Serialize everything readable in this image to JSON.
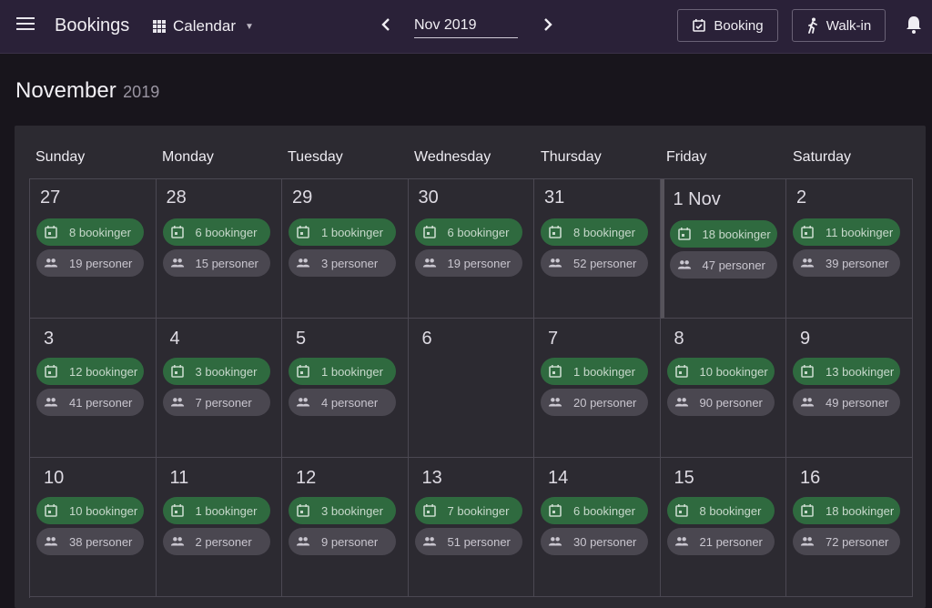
{
  "header": {
    "title": "Bookings",
    "view_label": "Calendar",
    "month_value": "Nov 2019",
    "booking_button": "Booking",
    "walkin_button": "Walk-in"
  },
  "page": {
    "month": "November",
    "year": "2019"
  },
  "weekdays": [
    "Sunday",
    "Monday",
    "Tuesday",
    "Wednesday",
    "Thursday",
    "Friday",
    "Saturday"
  ],
  "weeks": [
    [
      {
        "day": "27",
        "bookings": "8 bookinger",
        "persons": "19 personer"
      },
      {
        "day": "28",
        "bookings": "6 bookinger",
        "persons": "15 personer"
      },
      {
        "day": "29",
        "bookings": "1 bookinger",
        "persons": "3 personer"
      },
      {
        "day": "30",
        "bookings": "6 bookinger",
        "persons": "19 personer"
      },
      {
        "day": "31",
        "bookings": "8 bookinger",
        "persons": "52 personer"
      },
      {
        "day": "1  Nov",
        "bookings": "18 bookinger",
        "persons": "47 personer",
        "today": true
      },
      {
        "day": "2",
        "bookings": "11 bookinger",
        "persons": "39 personer"
      }
    ],
    [
      {
        "day": "3",
        "bookings": "12 bookinger",
        "persons": "41 personer"
      },
      {
        "day": "4",
        "bookings": "3 bookinger",
        "persons": "7 personer"
      },
      {
        "day": "5",
        "bookings": "1 bookinger",
        "persons": "4 personer"
      },
      {
        "day": "6",
        "bookings": "",
        "persons": ""
      },
      {
        "day": "7",
        "bookings": "1 bookinger",
        "persons": "20 personer"
      },
      {
        "day": "8",
        "bookings": "10 bookinger",
        "persons": "90 personer"
      },
      {
        "day": "9",
        "bookings": "13 bookinger",
        "persons": "49 personer"
      }
    ],
    [
      {
        "day": "10",
        "bookings": "10 bookinger",
        "persons": "38 personer"
      },
      {
        "day": "11",
        "bookings": "1 bookinger",
        "persons": "2 personer"
      },
      {
        "day": "12",
        "bookings": "3 bookinger",
        "persons": "9 personer"
      },
      {
        "day": "13",
        "bookings": "7 bookinger",
        "persons": "51 personer"
      },
      {
        "day": "14",
        "bookings": "6 bookinger",
        "persons": "30 personer"
      },
      {
        "day": "15",
        "bookings": "8 bookinger",
        "persons": "21 personer"
      },
      {
        "day": "16",
        "bookings": "18 bookinger",
        "persons": "72 personer"
      }
    ]
  ],
  "icons": {
    "menu": "menu-icon",
    "view": "grid-view-icon",
    "prev": "chevron-left-icon",
    "next": "chevron-right-icon",
    "booking": "calendar-check-icon",
    "walkin": "walking-person-icon",
    "bell": "bell-icon",
    "chip_booking": "calendar-icon",
    "chip_persons": "people-icon"
  },
  "colors": {
    "topbar": "#2a2138",
    "background": "#18151c",
    "panel": "#2c2a31",
    "booking_chip": "#2f6a3f",
    "persons_chip": "#4a4750"
  }
}
